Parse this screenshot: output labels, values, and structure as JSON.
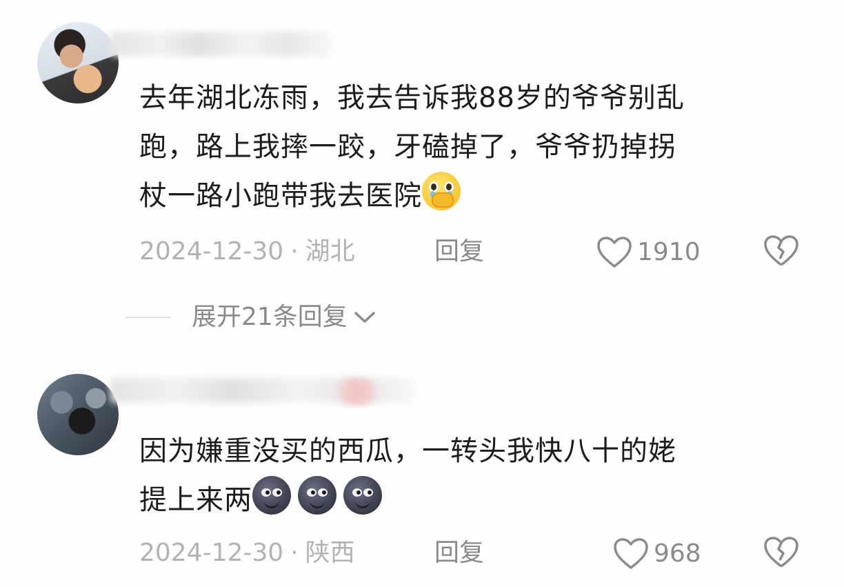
{
  "comments": [
    {
      "text_line1": "去年湖北冻雨，我去告诉我88岁的爷爷别乱",
      "text_line2": "跑，路上我摔一跤，牙磕掉了，爷爷扔掉拐",
      "text_line3": "杖一路小跑带我去医院",
      "emoji": "pleading-face-with-tears-emoji",
      "date": "2024-12-30",
      "separator": "·",
      "location": "湖北",
      "reply_label": "回复",
      "likes": "1910"
    },
    {
      "text_line1": "因为嫌重没买的西瓜，一转头我快八十的姥",
      "text_line2": "提上来两",
      "emoji": "new-moon-face-emoji",
      "emoji_count": 3,
      "date": "2024-12-30",
      "separator": "·",
      "location": "陕西",
      "reply_label": "回复",
      "likes": "968"
    }
  ],
  "expand_replies": {
    "label": "展开21条回复"
  },
  "icons": {
    "like": "heart-outline-icon",
    "dislike": "broken-heart-icon",
    "expand": "chevron-down-icon"
  },
  "colors": {
    "text": "#1c1c1c",
    "meta": "#b2b2b2",
    "secondary": "#8a8a8a"
  }
}
